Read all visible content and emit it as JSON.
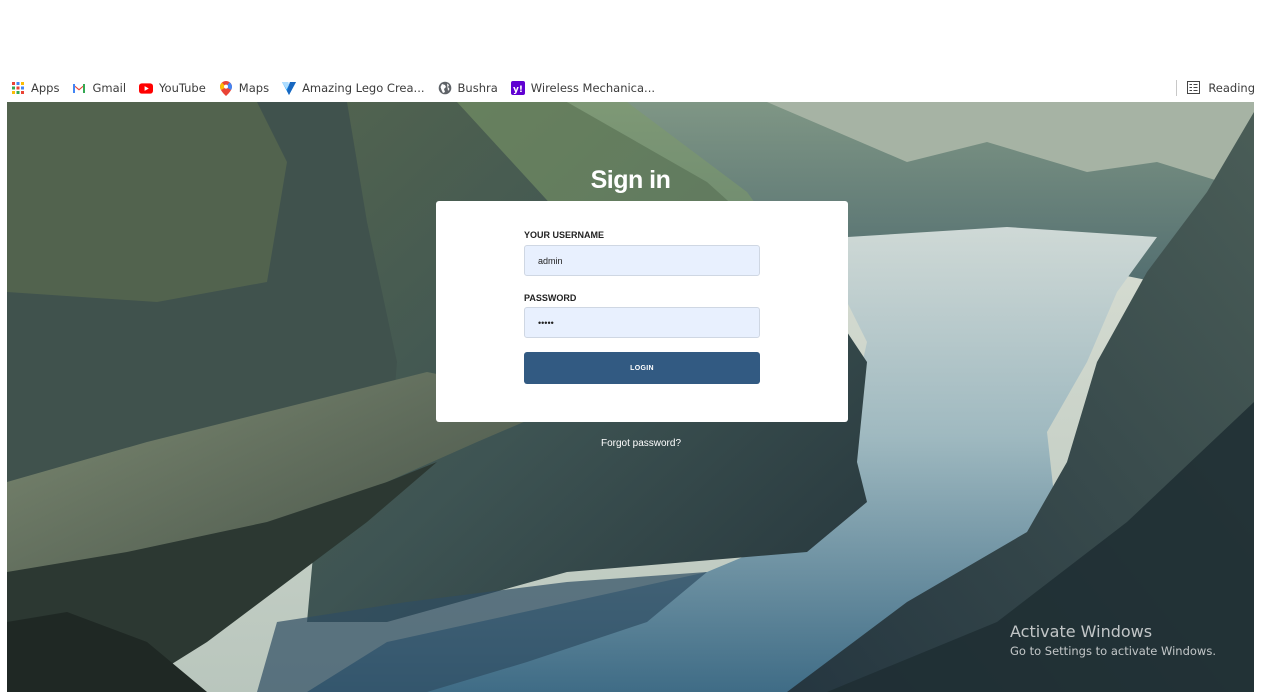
{
  "bookmarks": [
    {
      "label": "Apps",
      "icon": "apps-grid-icon"
    },
    {
      "label": "Gmail",
      "icon": "gmail-icon"
    },
    {
      "label": "YouTube",
      "icon": "youtube-icon"
    },
    {
      "label": "Maps",
      "icon": "maps-pin-icon"
    },
    {
      "label": "Amazing Lego Crea...",
      "icon": "vuetify-icon"
    },
    {
      "label": "Bushra",
      "icon": "globe-icon"
    },
    {
      "label": "Wireless Mechanica...",
      "icon": "yahoo-icon"
    }
  ],
  "reading_list": {
    "label": "Reading",
    "icon": "reading-list-icon"
  },
  "login": {
    "title": "Sign in",
    "username_label": "YOUR USERNAME",
    "username_value": "admin",
    "password_label": "PASSWORD",
    "password_value": "•••••",
    "button_label": "LOGIN",
    "forgot_link": "Forgot password?"
  },
  "watermark": {
    "line1": "Activate Windows",
    "line2": "Go to Settings to activate Windows."
  },
  "colors": {
    "button": "#325a82",
    "input_bg": "#e8f0fe",
    "card": "#ffffff"
  }
}
